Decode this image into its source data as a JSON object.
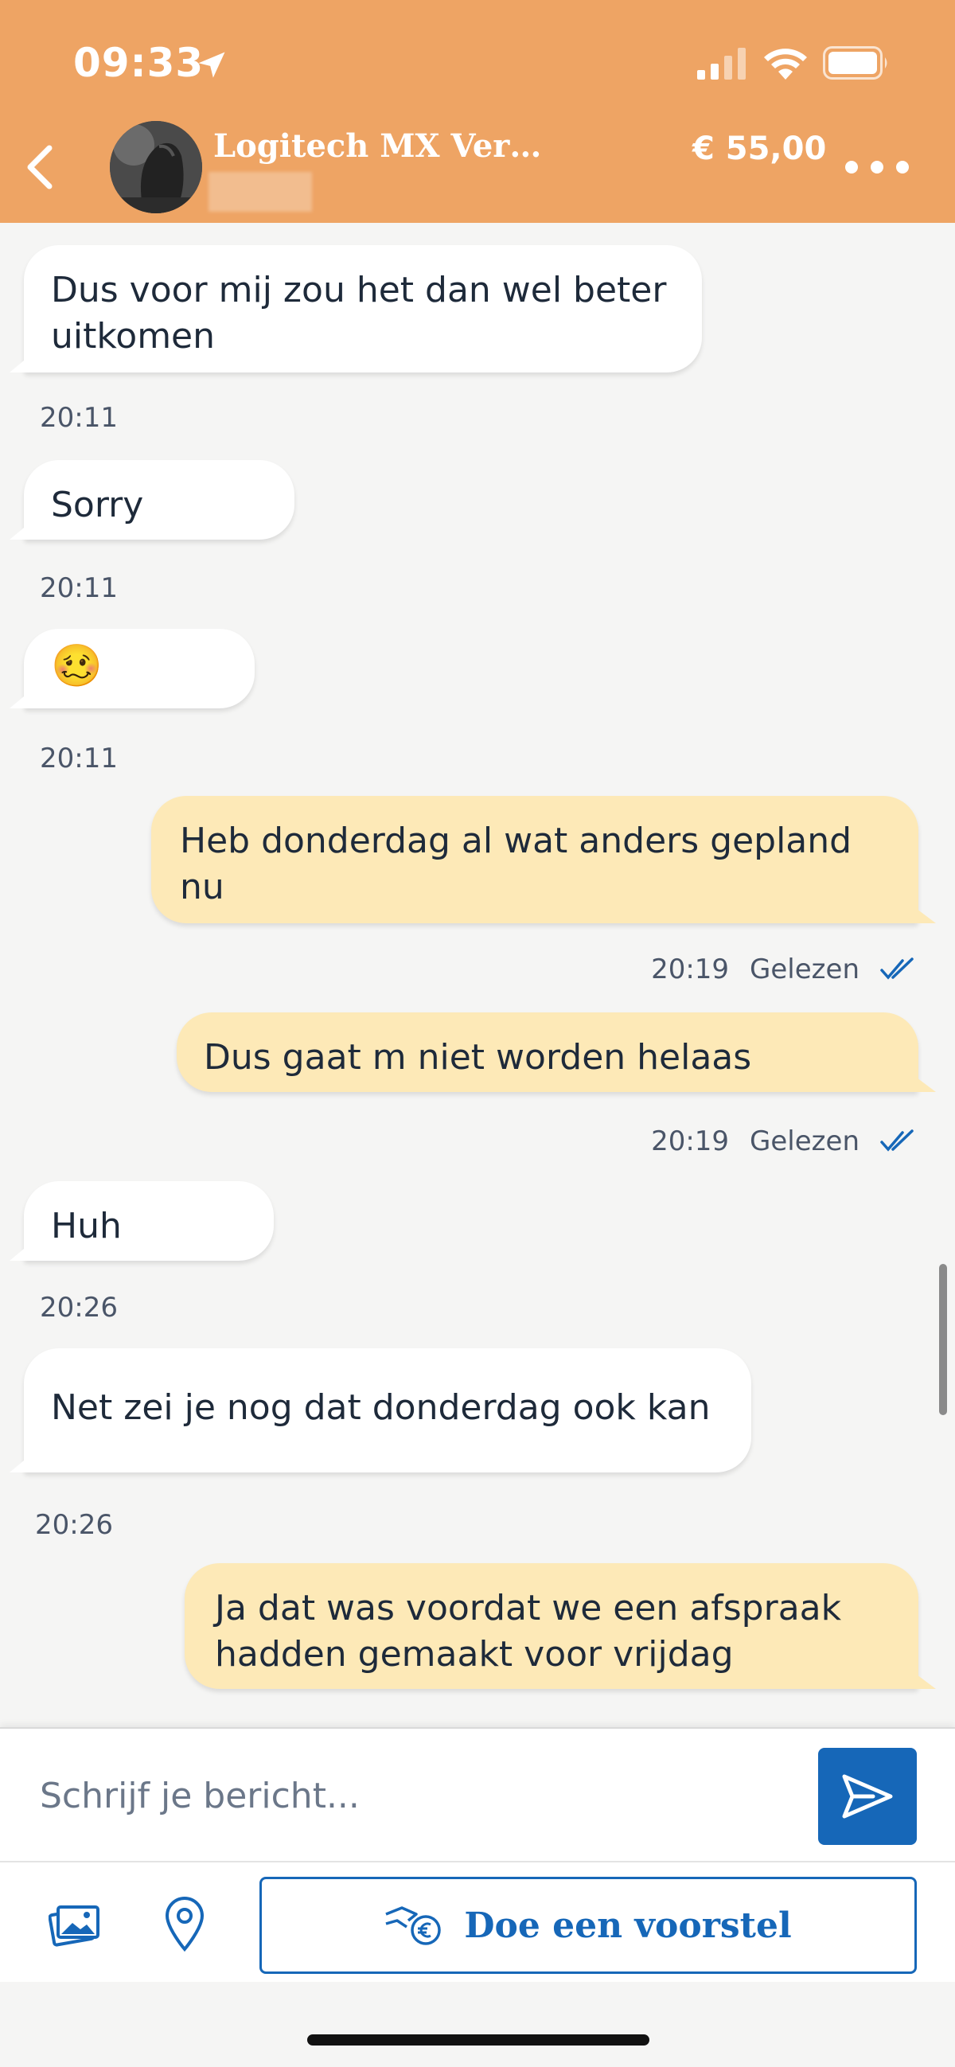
{
  "status_bar": {
    "time": "09:33",
    "icons": [
      "location-arrow-icon",
      "signal-icon",
      "wifi-icon",
      "battery-icon"
    ]
  },
  "header": {
    "title": "Logitech MX Vert...",
    "price": "€ 55,00",
    "icons": [
      "chevron-left-icon",
      "more-icon"
    ],
    "colors": {
      "background": "#eea464",
      "text": "#ffffff"
    }
  },
  "messages": [
    {
      "direction": "in",
      "text": "Dus voor mij zou het dan wel beter uitkomen",
      "time": "20:11"
    },
    {
      "direction": "in",
      "text": "Sorry",
      "time": "20:11"
    },
    {
      "direction": "in",
      "text": "🥴",
      "time": "20:11"
    },
    {
      "direction": "out",
      "text": "Heb donderdag al wat anders gepland nu",
      "time": "20:19",
      "status": "Gelezen"
    },
    {
      "direction": "out",
      "text": "Dus gaat m niet worden helaas",
      "time": "20:19",
      "status": "Gelezen"
    },
    {
      "direction": "in",
      "text": "Huh",
      "time": "20:26"
    },
    {
      "direction": "in",
      "text": "Net zei je nog dat donderdag ook kan",
      "time": "20:26"
    },
    {
      "direction": "out",
      "text": "Ja dat was voordat we een afspraak hadden gemaakt voor vrijdag"
    }
  ],
  "composer": {
    "placeholder": "Schrijf je bericht...",
    "send_icon": "send-icon"
  },
  "toolbar": {
    "offer_label": "Doe een voorstel",
    "icons": [
      "photo-icon",
      "location-pin-icon",
      "hand-euro-icon"
    ]
  },
  "colors": {
    "incoming_bubble": "#ffffff",
    "outgoing_bubble": "#fde9b7",
    "accent": "#1667b8",
    "background": "#f5f5f4"
  }
}
